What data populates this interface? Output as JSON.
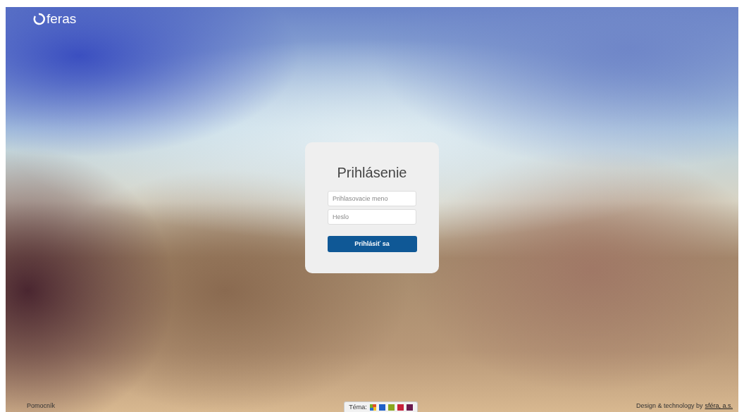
{
  "logo": {
    "text": "feras"
  },
  "login": {
    "title": "Prihlásenie",
    "username": {
      "placeholder": "Prihlasovacie meno"
    },
    "password": {
      "placeholder": "Heslo"
    },
    "submit": "Prihlásiť sa"
  },
  "footer": {
    "help_link": "Pomocník",
    "theme": {
      "label": "Téma:",
      "swatches": [
        {
          "kind": "multi",
          "color": "#e0502a"
        },
        {
          "kind": "plain",
          "color": "#1f5fc8"
        },
        {
          "kind": "plain",
          "color": "#8aa71e"
        },
        {
          "kind": "plain",
          "color": "#c8203a"
        },
        {
          "kind": "plain",
          "color": "#6a1a4e"
        }
      ]
    },
    "credit": "Design & technology by",
    "credit_link": "sféra, a.s."
  }
}
